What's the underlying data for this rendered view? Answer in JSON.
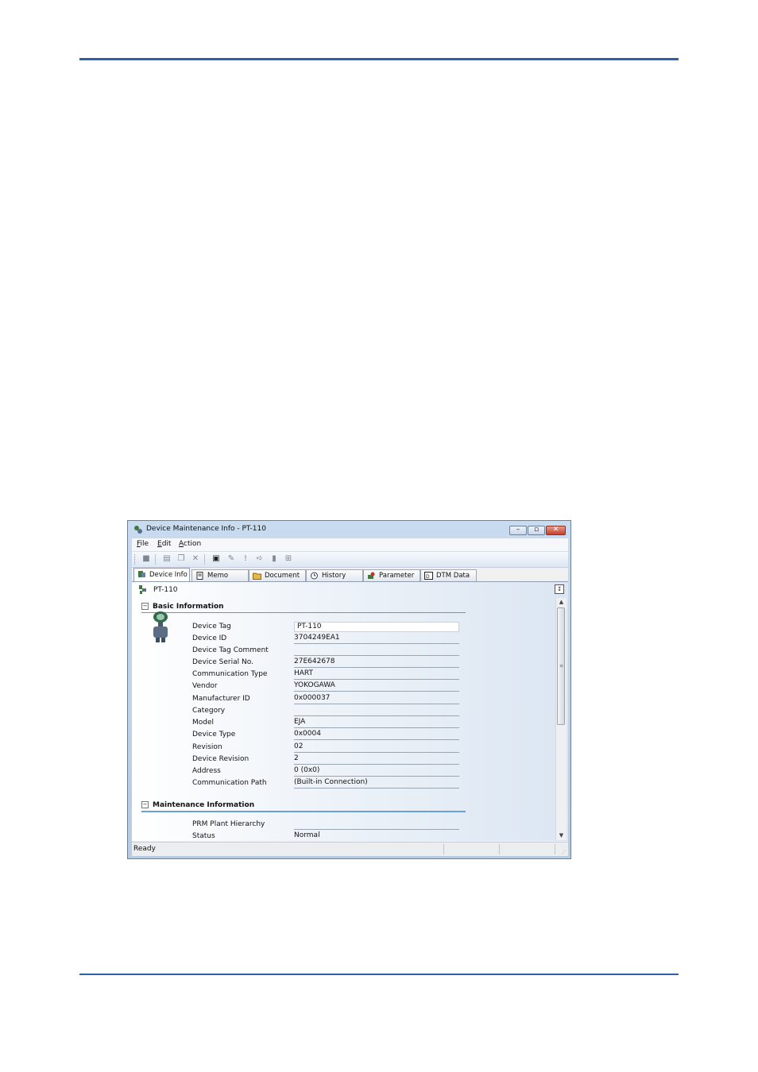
{
  "window": {
    "title": "Device Maintenance Info - PT-110",
    "caption_minimize": "–",
    "caption_restore": "▫",
    "caption_close": "✕"
  },
  "menu": [
    {
      "accel": "F",
      "rest": "ile"
    },
    {
      "accel": "E",
      "rest": "dit"
    },
    {
      "accel": "A",
      "rest": "ction"
    }
  ],
  "toolbar": {
    "icons": [
      "stop-icon",
      "new-icon",
      "copy-icon",
      "delete-icon",
      "dtm-icon",
      "edit-icon",
      "alert-icon",
      "forward-icon",
      "clipboard-icon",
      "compare-icon"
    ]
  },
  "tabs": [
    {
      "label": "Device Info",
      "icon": "device-info-icon",
      "active": true
    },
    {
      "label": "Memo",
      "icon": "memo-icon",
      "active": false
    },
    {
      "label": "Document",
      "icon": "folder-icon",
      "active": false
    },
    {
      "label": "History",
      "icon": "history-icon",
      "active": false
    },
    {
      "label": "Parameter",
      "icon": "parameter-icon",
      "active": false
    },
    {
      "label": "DTM Data",
      "icon": "dtm-data-icon",
      "active": false
    }
  ],
  "panel": {
    "device_tag": "PT-110",
    "corner_button": "↧"
  },
  "basic": {
    "header": "Basic Information",
    "rows": [
      {
        "label": "Device Tag",
        "value": "PT-110"
      },
      {
        "label": "Device ID",
        "value": "3704249EA1"
      },
      {
        "label": "Device Tag Comment",
        "value": ""
      },
      {
        "label": "Device Serial No.",
        "value": "27E642678"
      },
      {
        "label": "Communication Type",
        "value": "HART"
      },
      {
        "label": "Vendor",
        "value": "YOKOGAWA"
      },
      {
        "label": "Manufacturer ID",
        "value": "0x000037"
      },
      {
        "label": "Category",
        "value": ""
      },
      {
        "label": "Model",
        "value": "EJA"
      },
      {
        "label": "Device Type",
        "value": "0x0004"
      },
      {
        "label": "Revision",
        "value": "02"
      },
      {
        "label": "Device Revision",
        "value": "2"
      },
      {
        "label": "Address",
        "value": "0 (0x0)"
      },
      {
        "label": "Communication Path",
        "value": "(Built-in Connection)"
      }
    ]
  },
  "maintenance": {
    "header": "Maintenance Information",
    "rows": [
      {
        "label": "PRM Plant Hierarchy",
        "value": ""
      },
      {
        "label": "Status",
        "value": "Normal"
      }
    ]
  },
  "statusbar": {
    "text": "Ready"
  }
}
